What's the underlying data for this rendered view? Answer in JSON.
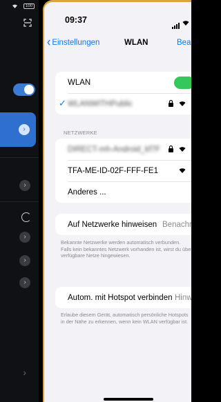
{
  "left_panel": {
    "battery_label": "100"
  },
  "status_bar": {
    "time": "09:37"
  },
  "nav": {
    "back_label": "Einstellungen",
    "title": "WLAN",
    "edit_label": "Bearbeiten"
  },
  "wlan_group": {
    "toggle_label": "WLAN",
    "toggle_on": true,
    "connected_network": "WLANWITHPublic"
  },
  "networks": {
    "header": "NETZWERKE",
    "items": [
      {
        "name": "DIRECT-mh-Android_kf7F",
        "secured": true,
        "blurred": true
      },
      {
        "name": "TFA-ME-ID-02F-FFF-FE1",
        "secured": false,
        "blurred": false
      }
    ],
    "other_label": "Anderes ..."
  },
  "ask_join": {
    "label": "Auf Netzwerke hinweisen",
    "value": "Benachrichtigen",
    "footnote_line1": "Bekannte Netzwerke werden automatisch verbunden.",
    "footnote_line2": "Falls kein bekanntes Netzwerk vorhanden ist, wirst du über",
    "footnote_line3": "verfügbare Netze hingewiesen."
  },
  "hotspot": {
    "label": "Autom. mit Hotspot verbinden",
    "value": "Hinweis",
    "footnote_line1": "Erlaube diesem Gerät, automatisch persönliche Hotspots",
    "footnote_line2": "in der Nähe zu erkennen, wenn kein WLAN verfügbar ist."
  },
  "colors": {
    "accent_blue": "#0a7aff",
    "toggle_green": "#34c759",
    "frame_gold": "#d9a441",
    "left_card_blue": "#2f6fce"
  }
}
